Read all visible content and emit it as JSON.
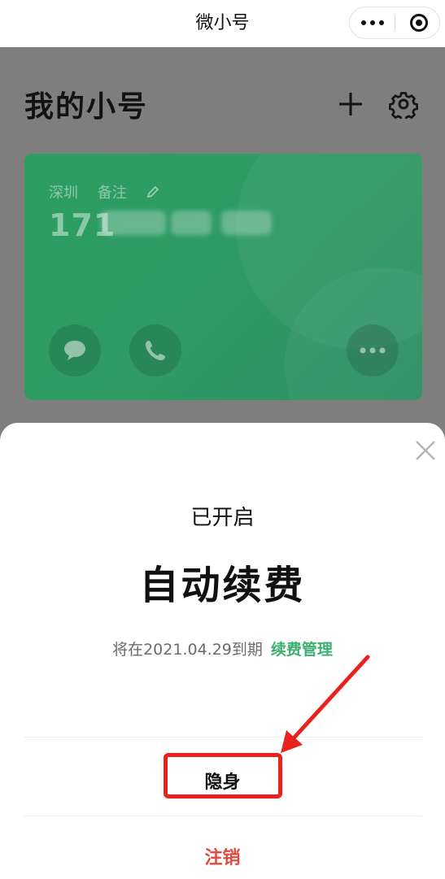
{
  "navbar": {
    "title": "微小号",
    "more_icon": "more-dots-icon",
    "close_icon": "target-circle-icon"
  },
  "page": {
    "title": "我的小号",
    "add_icon": "plus-icon",
    "settings_icon": "gear-icon"
  },
  "card": {
    "region": "深圳",
    "note_label": "备注",
    "number_prefix": "171",
    "number_blurred": true,
    "color": "#2e9b63",
    "actions": [
      "message-icon",
      "phone-icon",
      "more-icon"
    ]
  },
  "sheet": {
    "status": "已开启",
    "feature": "自动续费",
    "expire_text": "将在2021.04.29到期",
    "manage_link": "续费管理",
    "hide_label": "隐身",
    "cancel_label": "注销",
    "accent_color": "#3caf71",
    "danger_color": "#e04a42"
  },
  "annotation": {
    "color": "#e8231e",
    "target": "hide-button"
  }
}
